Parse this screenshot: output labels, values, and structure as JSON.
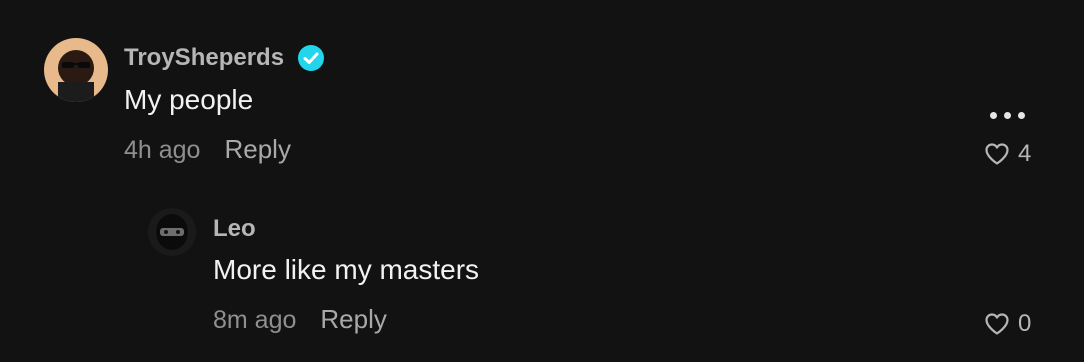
{
  "comments": [
    {
      "username": "TroySheperds",
      "verified": true,
      "text": "My people",
      "time": "4h ago",
      "reply_label": "Reply",
      "likes": "4",
      "avatar": "avatar-photo-man-sunglasses"
    },
    {
      "username": "Leo",
      "verified": false,
      "text": "More like my masters",
      "time": "8m ago",
      "reply_label": "Reply",
      "likes": "0",
      "avatar": "avatar-photo-masked-person"
    }
  ],
  "icons": {
    "verified": "verified-badge-icon",
    "more": "more-options-icon",
    "like": "heart-outline-icon"
  },
  "colors": {
    "background": "#121212",
    "username": "#b6b6b6",
    "text": "#f2f2f2",
    "meta": "#8f8f8f",
    "verified": "#20d5ec"
  }
}
